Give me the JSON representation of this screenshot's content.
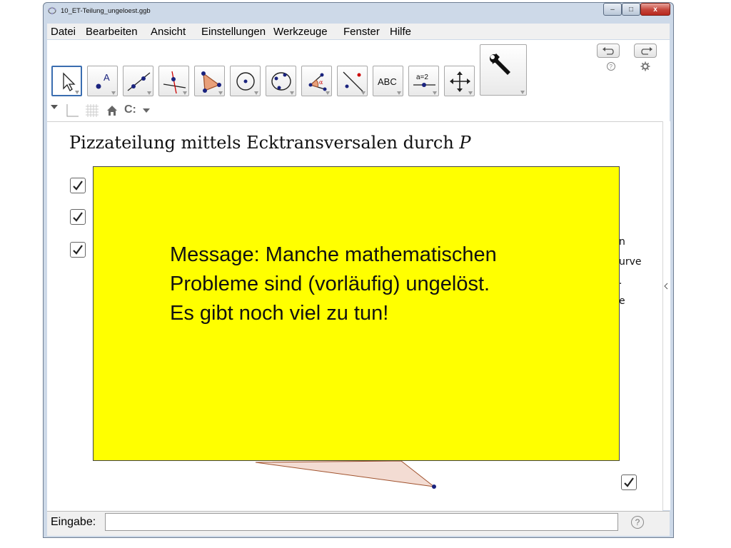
{
  "window": {
    "title": "10_ET-Teilung_ungeloest.ggb",
    "controls": {
      "minimize": "–",
      "maximize": "□",
      "close": "x"
    }
  },
  "menu": {
    "items": [
      "Datei",
      "Bearbeiten",
      "Ansicht",
      "Einstellungen",
      "Werkzeuge",
      "Fenster",
      "Hilfe"
    ]
  },
  "toolbar": {
    "tools": [
      {
        "name": "move-tool-icon"
      },
      {
        "name": "point-tool-icon",
        "label": "A"
      },
      {
        "name": "line-tool-icon"
      },
      {
        "name": "perpendicular-line-tool-icon"
      },
      {
        "name": "polygon-tool-icon"
      },
      {
        "name": "circle-tool-icon"
      },
      {
        "name": "ellipse-tool-icon"
      },
      {
        "name": "angle-tool-icon",
        "label": "α"
      },
      {
        "name": "reflect-tool-icon"
      },
      {
        "name": "text-tool-icon",
        "label": "ABC"
      },
      {
        "name": "slider-tool-icon",
        "label": "a=2"
      },
      {
        "name": "move-graphics-view-tool-icon"
      }
    ],
    "settings_icon": "wrench-icon",
    "undo_icon": "undo-icon",
    "redo_icon": "redo-icon",
    "help_icon": "help-icon",
    "gear_icon": "gear-icon"
  },
  "graphics_style_bar": {
    "icons": [
      "dropdown-arrow-icon",
      "axes-icon",
      "grid-icon",
      "home-icon",
      "point-capturing-icon"
    ],
    "capture_label": "C:"
  },
  "graphics": {
    "heading_text": "Pizzateilung mittels Ecktransversalen durch ",
    "heading_var": "P",
    "checkboxes_checked": [
      true,
      true,
      true,
      true
    ],
    "side_fragments": [
      "n",
      "urve",
      ".",
      "e"
    ]
  },
  "message": {
    "lines": [
      "Message: Manche mathematischen",
      "Probleme sind (vorläufig) ungelöst.",
      "Es gibt noch viel zu tun!"
    ],
    "background": "#ffff00"
  },
  "input_bar": {
    "label": "Eingabe:",
    "value": "",
    "help_symbol": "?"
  },
  "colors": {
    "triangle_fill": "#f3dcd3",
    "triangle_stroke": "#a0522d",
    "point": "#1a237e"
  }
}
